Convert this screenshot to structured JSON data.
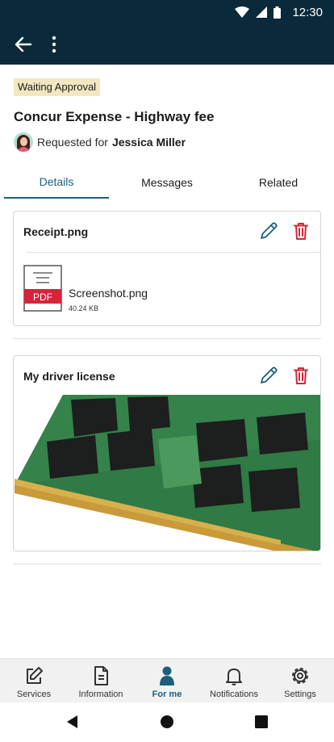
{
  "status_bar": {
    "time": "12:30"
  },
  "app_bar": {
    "back_icon": "arrow-left-icon",
    "more_icon": "more-vertical-icon"
  },
  "request": {
    "status_badge": "Waiting Approval",
    "title": "Concur Expense - Highway fee",
    "requested_label": "Requested for",
    "requested_for": "Jessica Miller"
  },
  "tabs": [
    {
      "label": "Details",
      "active": true
    },
    {
      "label": "Messages",
      "active": false
    },
    {
      "label": "Related",
      "active": false
    }
  ],
  "attachments": [
    {
      "title": "Receipt.png",
      "file": {
        "type_label": "PDF",
        "name": "Screenshot.png",
        "size": "40.24 KB"
      }
    },
    {
      "title": "My driver license",
      "image": "memory-module-photo"
    }
  ],
  "bottom_nav": [
    {
      "label": "Services",
      "icon": "edit-icon",
      "active": false
    },
    {
      "label": "Information",
      "icon": "document-icon",
      "active": false
    },
    {
      "label": "For me",
      "icon": "person-icon",
      "active": true
    },
    {
      "label": "Notifications",
      "icon": "bell-icon",
      "active": false
    },
    {
      "label": "Settings",
      "icon": "gear-icon",
      "active": false
    }
  ],
  "colors": {
    "header": "#0a2a3b",
    "accent": "#1b5f7a",
    "danger": "#d6243b",
    "badge_bg": "#f1e7c1"
  }
}
